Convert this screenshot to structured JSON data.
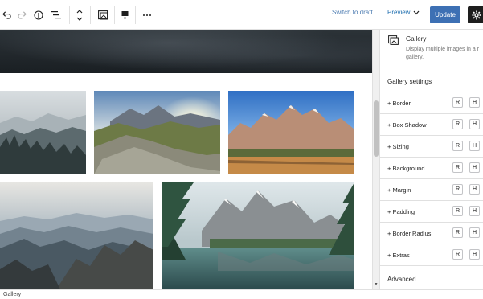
{
  "toolbar": {
    "switch_to_draft": "Switch to draft",
    "preview": "Preview",
    "update": "Update",
    "icons": [
      "undo-icon",
      "redo-icon",
      "info-icon",
      "list-view-icon",
      "move-up-down-icon",
      "block-transform-icon",
      "align-icon",
      "more-options-icon",
      "settings-gear-icon"
    ]
  },
  "sidebar": {
    "block_title": "Gallery",
    "block_description": "Display multiple images in a r gallery.",
    "settings_title": "Gallery settings",
    "panels": [
      {
        "label": "+ Border",
        "r": "R",
        "h": "H"
      },
      {
        "label": "+ Box Shadow",
        "r": "R",
        "h": "H"
      },
      {
        "label": "+ Sizing",
        "r": "R",
        "h": "H"
      },
      {
        "label": "+ Background",
        "r": "R",
        "h": "H"
      },
      {
        "label": "+ Margin",
        "r": "R",
        "h": "H"
      },
      {
        "label": "+ Padding",
        "r": "R",
        "h": "H"
      },
      {
        "label": "+ Border Radius",
        "r": "R",
        "h": "H"
      },
      {
        "label": "+ Extras",
        "r": "R",
        "h": "H"
      }
    ],
    "advanced": "Advanced"
  },
  "status_bar": {
    "breadcrumb": "Gallery"
  },
  "colors": {
    "accent": "#3d70b4",
    "link": "#2271b1",
    "dark": "#1e1e1e",
    "border": "#e0e0e0"
  }
}
